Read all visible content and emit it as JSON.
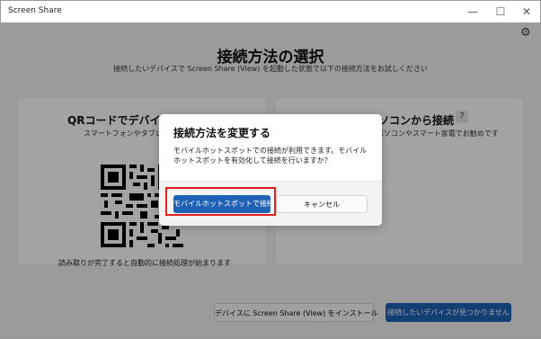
{
  "window": {
    "title": "Screen Share",
    "minimize_glyph": "—",
    "maximize_glyph": "☐",
    "close_glyph": "✕"
  },
  "header": {
    "title": "接続方法の選択",
    "subtitle": "接続したいデバイスで Screen Share (View) を起動した状態で以下の接続方法をお試しください"
  },
  "settings": {
    "icon": "gear-icon",
    "glyph": "⚙"
  },
  "cards": {
    "qr": {
      "title": "QRコードでデバイスから接続",
      "desc": "スマートフォンやタブレットでQRコードを読み取ってください",
      "hint": "読み取りが完了すると自動的に接続処理が始まります"
    },
    "pc": {
      "title": "パソコンから接続",
      "desc": "パソコンやスマート家電でお勧めです",
      "help_glyph": "?"
    }
  },
  "footer": {
    "install_label": "デバイスに Screen Share (View) をインストール",
    "not_found_label": "接続したいデバイスが見つかりません"
  },
  "dialog": {
    "title": "接続方法を変更する",
    "message": "モバイルホットスポットでの接続が利用できます。モバイルホットスポットを有効化して接続を行いますか？",
    "primary_label": "モバイルホットスポットで接続",
    "cancel_label": "キャンセル"
  },
  "colors": {
    "accent": "#1f62b5",
    "highlight": "#e01f1f",
    "overlay": "rgba(0,0,0,0.36)"
  }
}
